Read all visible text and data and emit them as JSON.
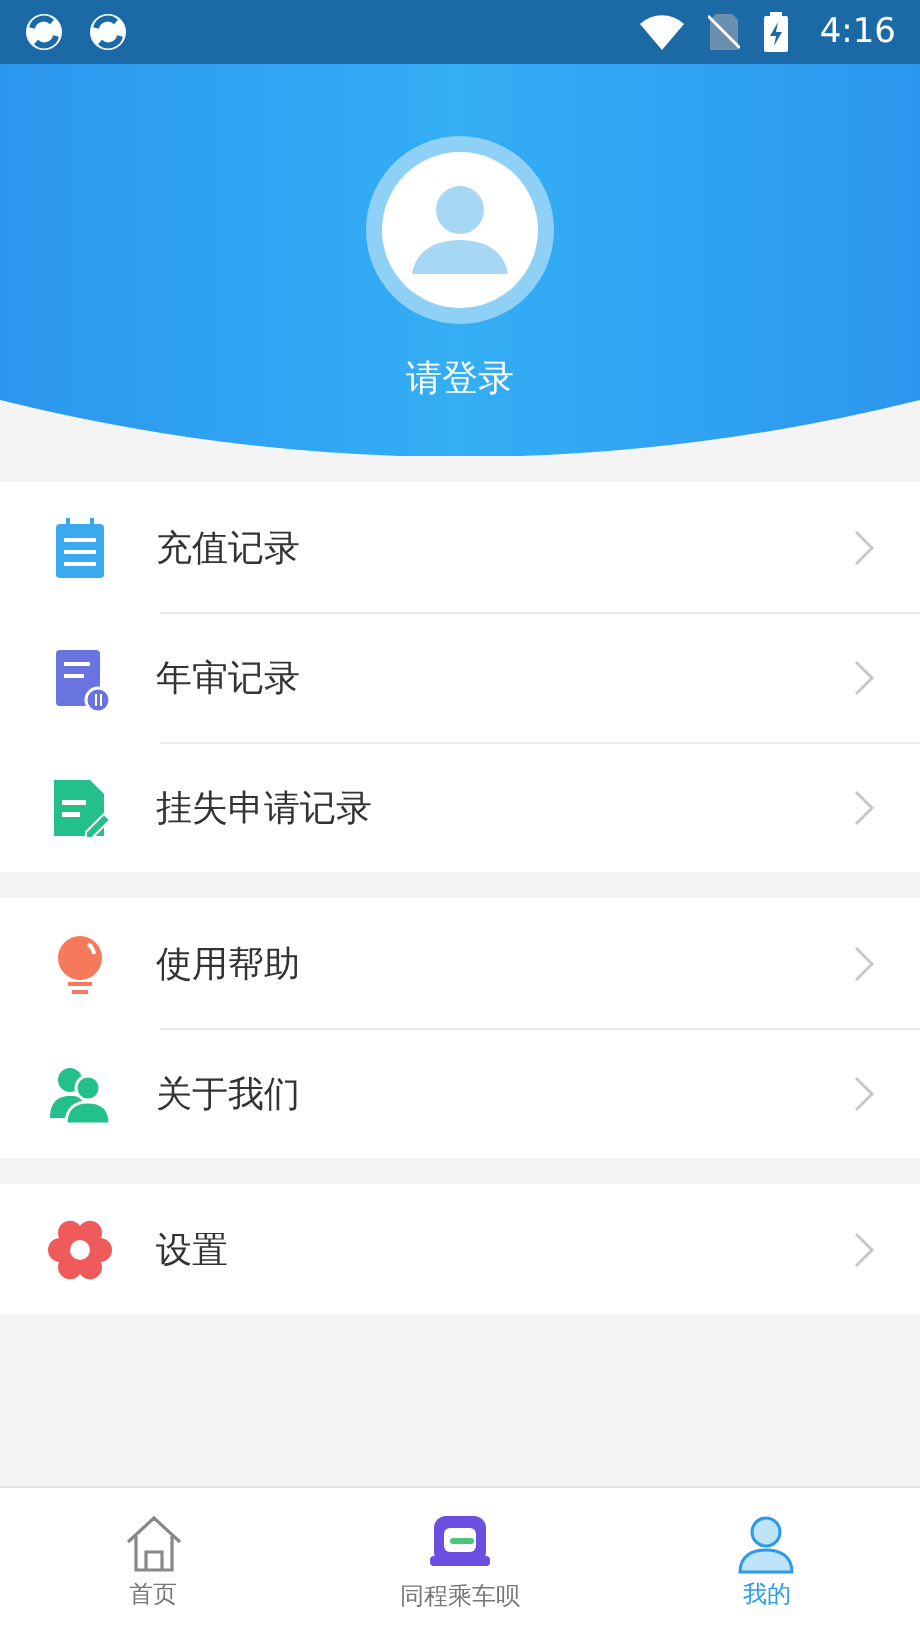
{
  "status_bar": {
    "time": "4:16"
  },
  "profile": {
    "login_label": "请登录"
  },
  "menu_groups": [
    {
      "items": [
        {
          "label": "充值记录",
          "kind": "notepad"
        },
        {
          "label": "年审记录",
          "kind": "review"
        },
        {
          "label": "挂失申请记录",
          "kind": "report"
        }
      ]
    },
    {
      "items": [
        {
          "label": "使用帮助",
          "kind": "help"
        },
        {
          "label": "关于我们",
          "kind": "about"
        }
      ]
    },
    {
      "items": [
        {
          "label": "设置",
          "kind": "settings"
        }
      ]
    }
  ],
  "tab_bar": [
    {
      "label": "首页",
      "kind": "home",
      "selected": false
    },
    {
      "label": "同程乘车呗",
      "kind": "ride",
      "selected": false
    },
    {
      "label": "我的",
      "kind": "profile",
      "selected": true
    }
  ]
}
